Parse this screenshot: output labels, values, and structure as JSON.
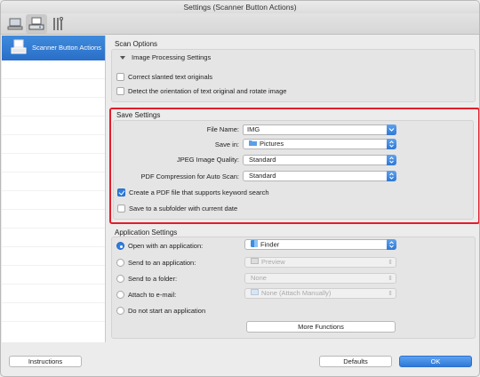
{
  "window": {
    "title": "Settings (Scanner Button Actions)"
  },
  "toolbar": {
    "tabs": [
      {
        "icon": "computer-icon"
      },
      {
        "icon": "scanner-icon"
      },
      {
        "icon": "general-settings-icon"
      }
    ]
  },
  "sidebar": {
    "items": [
      {
        "label": "Scanner Button Actions",
        "icon": "scanner-icon"
      }
    ]
  },
  "scan_options": {
    "title": "Scan Options",
    "image_processing_label": "Image Processing Settings",
    "correct_slanted": {
      "label": "Correct slanted text originals",
      "checked": false
    },
    "detect_orientation": {
      "label": "Detect the orientation of text original and rotate image",
      "checked": false
    }
  },
  "save_settings": {
    "title": "Save Settings",
    "file_name_label": "File Name:",
    "file_name_value": "IMG",
    "save_in_label": "Save in:",
    "save_in_value": "Pictures",
    "jpeg_label": "JPEG Image Quality:",
    "jpeg_value": "Standard",
    "pdf_label": "PDF Compression for Auto Scan:",
    "pdf_value": "Standard",
    "keyword_pdf": {
      "label": "Create a PDF file that supports keyword search",
      "checked": true
    },
    "subfolder": {
      "label": "Save to a subfolder with current date",
      "checked": false
    }
  },
  "app_settings": {
    "title": "Application Settings",
    "open_with": {
      "label": "Open with an application:",
      "value": "Finder",
      "selected": true
    },
    "send_app": {
      "label": "Send to an application:",
      "value": "Preview",
      "selected": false
    },
    "send_folder": {
      "label": "Send to a folder:",
      "value": "None",
      "selected": false
    },
    "attach_email": {
      "label": "Attach to e-mail:",
      "value": "None (Attach Manually)",
      "selected": false
    },
    "do_not_start": {
      "label": "Do not start an application",
      "selected": false
    },
    "more_functions": "More Functions"
  },
  "footer": {
    "instructions": "Instructions",
    "defaults": "Defaults",
    "ok": "OK"
  },
  "colors": {
    "accent": "#2f78d8",
    "highlight": "#e21d2a"
  }
}
